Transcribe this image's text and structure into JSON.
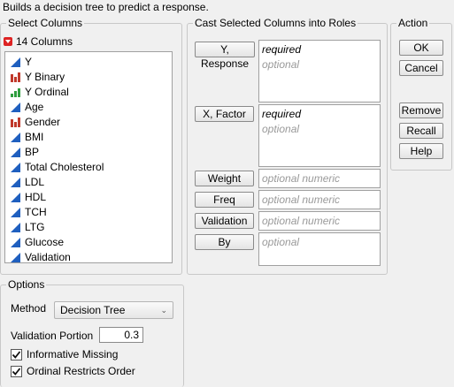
{
  "description": "Builds a decision tree to predict a response.",
  "select_columns": {
    "title": "Select Columns",
    "count_label": "14 Columns",
    "columns": [
      {
        "label": "Y",
        "icon": "continuous"
      },
      {
        "label": "Y Binary",
        "icon": "nominal"
      },
      {
        "label": "Y Ordinal",
        "icon": "ordinal"
      },
      {
        "label": "Age",
        "icon": "continuous"
      },
      {
        "label": "Gender",
        "icon": "nominal"
      },
      {
        "label": "BMI",
        "icon": "continuous"
      },
      {
        "label": "BP",
        "icon": "continuous"
      },
      {
        "label": "Total Cholesterol",
        "icon": "continuous"
      },
      {
        "label": "LDL",
        "icon": "continuous"
      },
      {
        "label": "HDL",
        "icon": "continuous"
      },
      {
        "label": "TCH",
        "icon": "continuous"
      },
      {
        "label": "LTG",
        "icon": "continuous"
      },
      {
        "label": "Glucose",
        "icon": "continuous"
      },
      {
        "label": "Validation",
        "icon": "continuous"
      }
    ]
  },
  "roles": {
    "title": "Cast Selected Columns into Roles",
    "y_response": {
      "button": "Y, Response",
      "required": "required",
      "optional": "optional"
    },
    "x_factor": {
      "button": "X, Factor",
      "required": "required",
      "optional": "optional"
    },
    "weight": {
      "button": "Weight",
      "placeholder": "optional numeric"
    },
    "freq": {
      "button": "Freq",
      "placeholder": "optional numeric"
    },
    "validation": {
      "button": "Validation",
      "placeholder": "optional numeric"
    },
    "by": {
      "button": "By",
      "placeholder": "optional"
    }
  },
  "action": {
    "title": "Action",
    "ok": "OK",
    "cancel": "Cancel",
    "remove": "Remove",
    "recall": "Recall",
    "help": "Help"
  },
  "options": {
    "title": "Options",
    "method_label": "Method",
    "method_value": "Decision Tree",
    "validation_portion_label": "Validation Portion",
    "validation_portion_value": "0.3",
    "informative_missing": "Informative Missing",
    "informative_missing_checked": true,
    "ordinal_restricts_order": "Ordinal Restricts Order",
    "ordinal_restricts_order_checked": true
  },
  "colors": {
    "continuous_icon": "#1f5fbf",
    "nominal_icon": "#c0392b",
    "ordinal_icon": "#2e9e3e",
    "menu_triangle": "#dd2222"
  }
}
